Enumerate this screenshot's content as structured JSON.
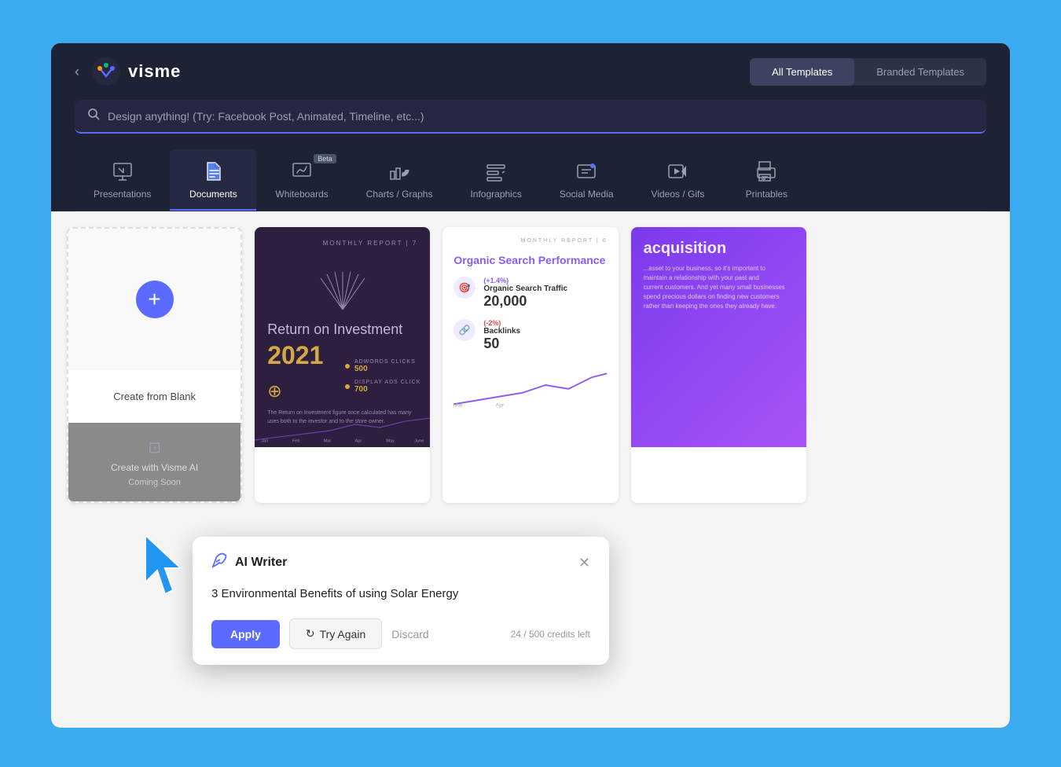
{
  "app": {
    "title": "visme",
    "background_color": "#3aabf0"
  },
  "header": {
    "back_label": "‹",
    "logo_text": "visme",
    "toggle": {
      "all_templates": "All Templates",
      "branded_templates": "Branded Templates"
    },
    "search": {
      "placeholder": "Design anything! (Try: Facebook Post, Animated, Timeline, etc...)"
    }
  },
  "nav_tabs": [
    {
      "id": "presentations",
      "label": "Presentations",
      "active": false
    },
    {
      "id": "documents",
      "label": "Documents",
      "active": true
    },
    {
      "id": "whiteboards",
      "label": "Whiteboards",
      "active": false,
      "beta": true
    },
    {
      "id": "charts",
      "label": "Charts / Graphs",
      "active": false
    },
    {
      "id": "infographics",
      "label": "Infographics",
      "active": false
    },
    {
      "id": "social_media",
      "label": "Social Media",
      "active": false
    },
    {
      "id": "videos_gifs",
      "label": "Videos / Gifs",
      "active": false
    },
    {
      "id": "printables",
      "label": "Printables",
      "active": false
    }
  ],
  "create_blank": {
    "label": "Create from Blank",
    "ai_label": "Create with Visme AI",
    "ai_coming_soon": "Coming Soon"
  },
  "templates": [
    {
      "id": "roi-report",
      "type": "dark",
      "header_text": "MONTHLY REPORT | 7",
      "title": "Return on Investment",
      "year": "2021",
      "body_text": "The Return on Investment figure once calculated has many uses both to the investor and to the store owner.",
      "stats": [
        {
          "label": "ADWORDS CLICKS",
          "value": "500"
        },
        {
          "label": "DISPLAY ADS CLICK",
          "value": "700"
        }
      ]
    },
    {
      "id": "organic-search",
      "type": "light",
      "header_text": "MONTHLY REPORT | 6",
      "title": "Organic Search Performance",
      "metrics": [
        {
          "change": "(+1.4%)",
          "name": "Organic Search Traffic",
          "value": "20,000"
        },
        {
          "change": "(-2%)",
          "name": "Backlinks",
          "value": "50"
        }
      ]
    },
    {
      "id": "acquisition",
      "type": "purple",
      "title": "acquisition"
    }
  ],
  "ai_writer_popup": {
    "title": "AI Writer",
    "generated_text": "3 Environmental Benefits of using Solar Energy",
    "apply_label": "Apply",
    "try_again_label": "Try Again",
    "discard_label": "Discard",
    "credits_used": "24",
    "credits_total": "500",
    "credits_label": "credits left"
  }
}
